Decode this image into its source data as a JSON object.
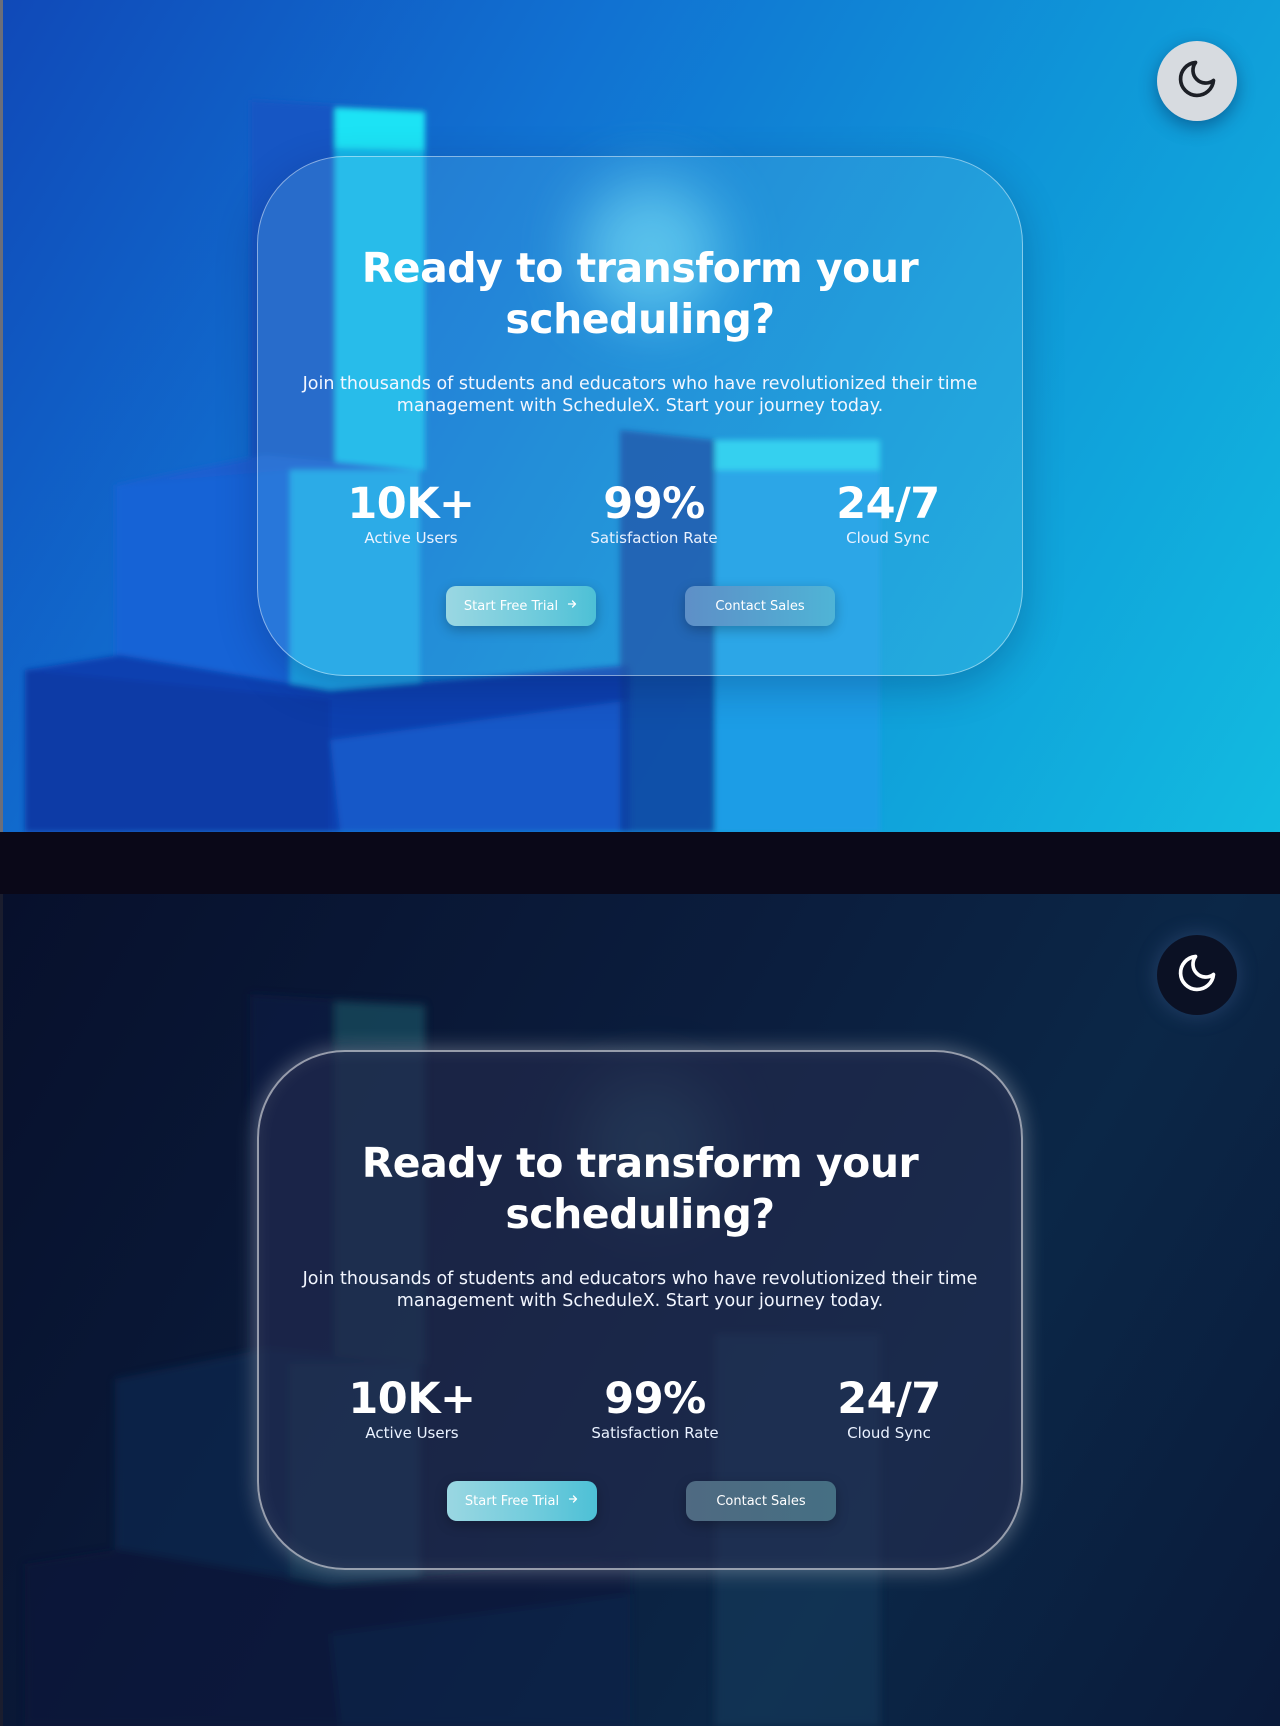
{
  "theme_toggle": {
    "icon": "moon-icon"
  },
  "card": {
    "title_line_1": "Ready to transform your",
    "title_line_2": "scheduling?",
    "subtitle_line_1": "Join thousands of students and educators who have revolutionized their time",
    "subtitle_line_2": "management with ScheduleX. Start your journey today."
  },
  "stats": [
    {
      "value": "10K+",
      "label": "Active Users"
    },
    {
      "value": "99%",
      "label": "Satisfaction Rate"
    },
    {
      "value": "24/7",
      "label": "Cloud Sync"
    }
  ],
  "buttons": {
    "primary_label": "Start Free Trial",
    "primary_icon": "arrow-right-icon",
    "secondary_label": "Contact Sales"
  },
  "colors": {
    "light_background": "#1172d2",
    "dark_background": "#0b1d3d",
    "primary_button": "#6fcbdc"
  }
}
